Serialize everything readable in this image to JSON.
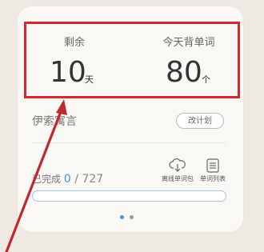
{
  "stats": {
    "remaining_label": "剩余",
    "remaining_value": "10",
    "remaining_unit": "天",
    "today_label": "今天背单词",
    "today_value": "80",
    "today_unit": "个"
  },
  "book": {
    "title": "伊索寓言",
    "change_plan_label": "改计划"
  },
  "progress": {
    "completed_label": "已完成",
    "completed": "0",
    "separator": " / ",
    "total": "727",
    "fraction": 0
  },
  "tools": [
    {
      "label": "离线单词包",
      "icon": "cloud-download-icon"
    },
    {
      "label": "单词列表",
      "icon": "list-icon"
    }
  ],
  "pagination": {
    "active_color": "#4a90e2",
    "inactive_color": "#999999"
  },
  "colors": {
    "highlight": "#d4272f",
    "accent": "#4a90e2"
  }
}
